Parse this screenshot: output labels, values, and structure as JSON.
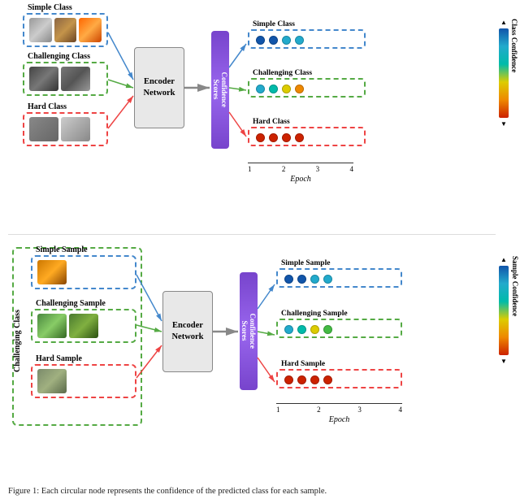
{
  "top": {
    "classes": {
      "simple": {
        "label": "Simple Class",
        "border": "blue"
      },
      "challenging": {
        "label": "Challenging Class",
        "border": "green"
      },
      "hard": {
        "label": "Hard Class",
        "border": "red"
      }
    },
    "encoder": {
      "label": "Encoder\nNetwork"
    },
    "confidence": {
      "label": "Confidence\nScores"
    },
    "outputs": {
      "simple": {
        "label": "Simple Class"
      },
      "challenging": {
        "label": "Challenging Class"
      },
      "hard": {
        "label": "Hard Class"
      }
    },
    "colorbar": {
      "label": "Class Confidence"
    },
    "epoch": {
      "label": "Epoch",
      "ticks": [
        "1",
        "2",
        "3",
        "4"
      ]
    }
  },
  "bottom": {
    "outer_label": "Challenging Class",
    "samples": {
      "simple": {
        "label": "Simple Sample",
        "border": "blue"
      },
      "challenging": {
        "label": "Challenging Sample",
        "border": "green"
      },
      "hard": {
        "label": "Hard Sample",
        "border": "red"
      }
    },
    "encoder": {
      "label": "Encoder\nNetwork"
    },
    "confidence": {
      "label": "Confidence\nScores"
    },
    "outputs": {
      "simple": {
        "label": "Simple Sample"
      },
      "challenging": {
        "label": "Challenging Sample"
      },
      "hard": {
        "label": "Hard Sample"
      }
    },
    "colorbar": {
      "label": "Sample Confidence"
    },
    "epoch": {
      "label": "Epoch",
      "ticks": [
        "1",
        "2",
        "3",
        "4"
      ]
    }
  },
  "caption": {
    "text": "Figure 1: Each circular node represents the confidence of the predicted class for each sample."
  }
}
